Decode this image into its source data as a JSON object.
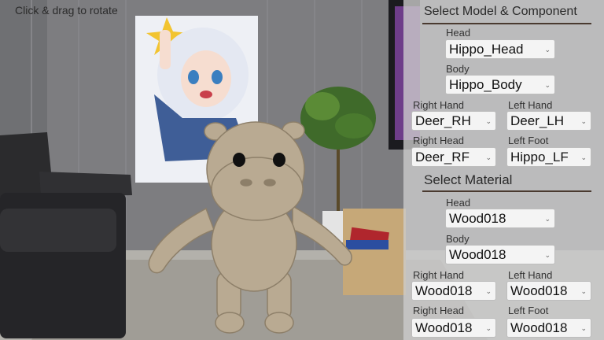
{
  "hint": "Click & drag to rotate",
  "panel": {
    "model_section_title": "Select Model & Component",
    "material_section_title": "Select Material",
    "model": {
      "head": {
        "label": "Head",
        "value": "Hippo_Head"
      },
      "body": {
        "label": "Body",
        "value": "Hippo_Body"
      },
      "right_hand": {
        "label": "Right Hand",
        "value": "Deer_RH"
      },
      "left_hand": {
        "label": "Left Hand",
        "value": "Deer_LH"
      },
      "right_head": {
        "label": "Right Head",
        "value": "Deer_RF"
      },
      "left_foot": {
        "label": "Left Foot",
        "value": "Hippo_LF"
      }
    },
    "material": {
      "head": {
        "label": "Head",
        "value": "Wood018"
      },
      "body": {
        "label": "Body",
        "value": "Wood018"
      },
      "right_hand": {
        "label": "Right Hand",
        "value": "Wood018"
      },
      "left_hand": {
        "label": "Left Hand",
        "value": "Wood018"
      },
      "right_head": {
        "label": "Right Head",
        "value": "Wood018"
      },
      "left_foot": {
        "label": "Left Foot",
        "value": "Wood018"
      }
    }
  },
  "colors": {
    "panel_bg": "#cdcdcd",
    "rule": "#4a3a30",
    "wood": "#b9aa92"
  },
  "icons": {
    "dropdown": "chevron-down-icon"
  }
}
